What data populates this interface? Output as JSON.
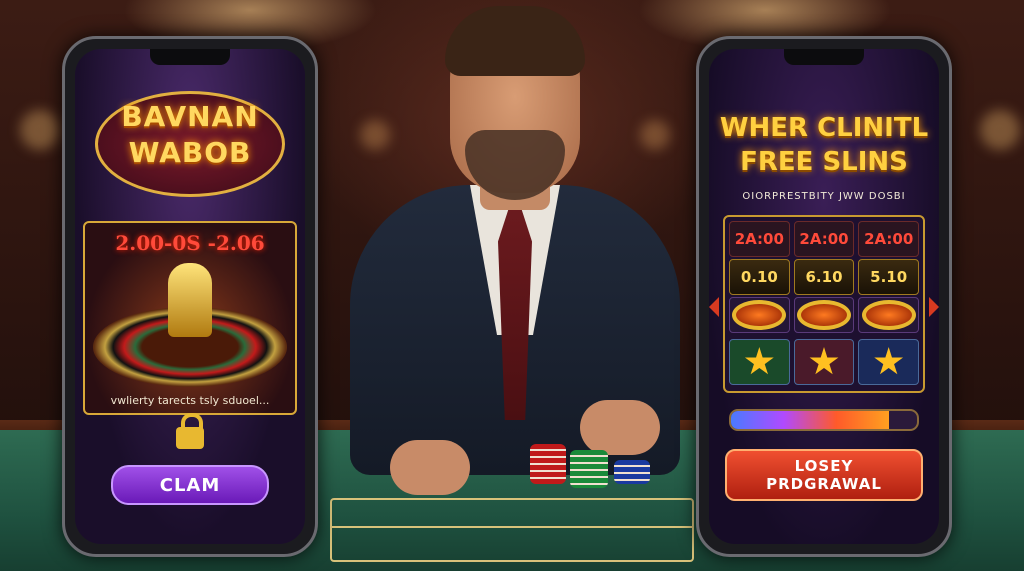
{
  "left_phone": {
    "logo_line1": "BAVNAN",
    "logo_line2": "WABOB",
    "odds_text": "2.00-0S -2.06",
    "tagline": "vwlierty tarects tsly sduoel...",
    "claim_label": "CLAM"
  },
  "right_phone": {
    "title_line1": "WHER CLINITL",
    "title_line2": "FREE SLINS",
    "subtitle": "OIORPRESTBITY JWW DOSBI",
    "top_row": [
      "2A:00",
      "2A:00",
      "2A:00"
    ],
    "value_row": [
      "0.10",
      "6.10",
      "5.10"
    ],
    "progress": 0.85,
    "withdraw_line1": "LOSEY",
    "withdraw_line2": "PRDGRAWAL"
  },
  "colors": {
    "claim_button": "#8a30d8",
    "withdraw_button": "#d83a20",
    "gold": "#ffd040"
  },
  "icons": [
    "lock-icon",
    "trophy-icon",
    "roulette-wheel",
    "star-icon",
    "chevron-left-icon",
    "chevron-right-icon"
  ]
}
